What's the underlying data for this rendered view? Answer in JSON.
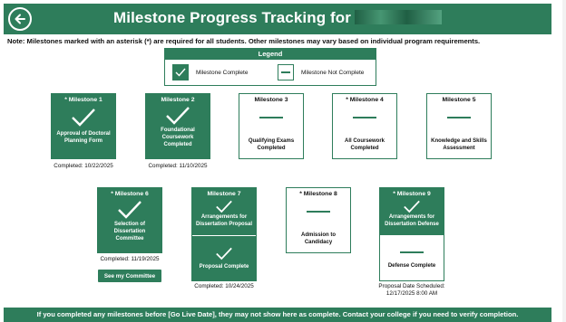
{
  "header": {
    "title": "Milestone Progress Tracking for",
    "back_icon": "arrow-left-icon"
  },
  "note": "Note: Milestones marked with an asterisk (*) are required for all students. Other milestones may vary based on individual program requirements.",
  "legend": {
    "title": "Legend",
    "complete": "Milestone Complete",
    "not_complete": "Milestone Not Complete"
  },
  "milestones": {
    "m1": {
      "title": "* Milestone 1",
      "label": "Approval of Doctoral Planning Form",
      "caption": "Completed: 10/22/2025"
    },
    "m2": {
      "title": "Milestone 2",
      "label": "Foundational Coursework Completed",
      "caption": "Completed: 11/10/2025"
    },
    "m3": {
      "title": "Milestone 3",
      "label": "Qualifying Exams Completed"
    },
    "m4": {
      "title": "* Milestone 4",
      "label": "All Coursework Completed"
    },
    "m5": {
      "title": "Milestone 5",
      "label": "Knowledge and Skills Assessment"
    },
    "m6": {
      "title": "* Milestone 6",
      "label": "Selection of Dissertation Committee",
      "caption": "Completed: 11/19/2025",
      "button": "See my Committee"
    },
    "m7": {
      "title": "Milestone 7",
      "label_top": "Arrangements for Dissertation Proposal",
      "label_bottom": "Proposal Complete",
      "caption": "Completed: 10/24/2025"
    },
    "m8": {
      "title": "* Milestone 8",
      "label": "Admission to Candidacy"
    },
    "m9": {
      "title": "* Milestone 9",
      "label_top": "Arrangements for Dissertation Defense",
      "label_bottom": "Defense Complete",
      "caption_1": "Proposal Date Scheduled:",
      "caption_2": "12/17/2025 8:00 AM"
    }
  },
  "footer": "If you completed any milestones before [Go Live Date], they may not show here as complete. Contact your college if you need to verify completion.",
  "colors": {
    "brand": "#2e7d5b"
  }
}
